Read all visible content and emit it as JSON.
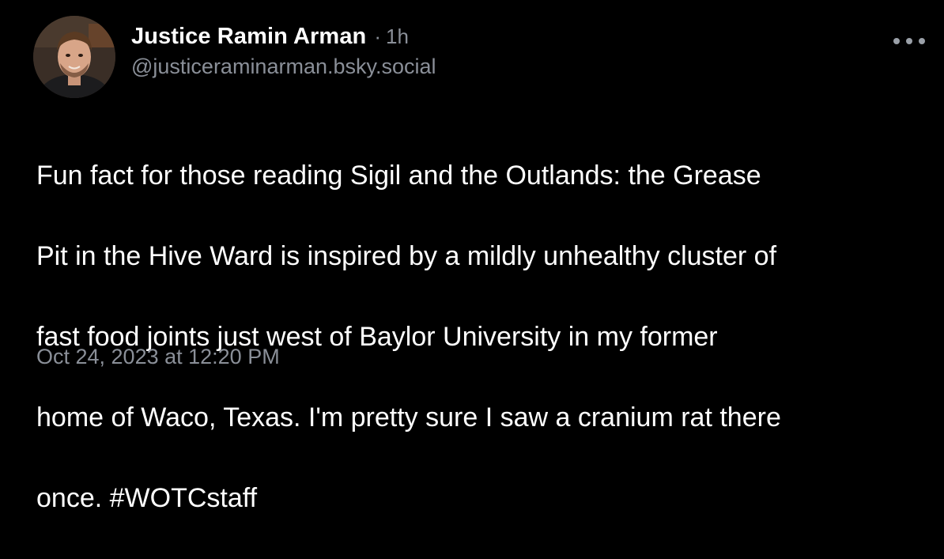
{
  "post": {
    "author": {
      "display_name": "Justice Ramin Arman",
      "separator": "·",
      "time_ago": "1h",
      "handle": "@justiceraminarman.bsky.social"
    },
    "text_lines": [
      "Fun fact for those reading Sigil and the Outlands: the Grease",
      "Pit in the Hive Ward is inspired by a mildly unhealthy cluster of",
      "fast food joints just west of Baylor University in my former",
      "home of Waco, Texas. I'm pretty sure I saw a cranium rat there"
    ],
    "last_line_text": "once. ",
    "hashtag": "#WOTCstaff",
    "timestamp": "Oct 24, 2023 at 12:20 PM",
    "more_icon": "more-horizontal-icon"
  },
  "colors": {
    "background": "#000000",
    "primary_text": "#ffffff",
    "secondary_text": "#8a8f98"
  }
}
